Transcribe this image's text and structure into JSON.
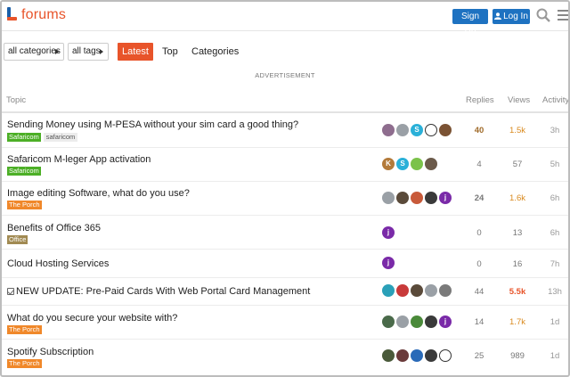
{
  "header": {
    "logo_text": "forums",
    "signup_label": "Sign Up",
    "login_label": "Log In"
  },
  "nav": {
    "categories_dropdown": "all categories",
    "tags_dropdown": "all tags",
    "tabs": [
      {
        "label": "Latest",
        "active": true
      },
      {
        "label": "Top",
        "active": false
      },
      {
        "label": "Categories",
        "active": false
      }
    ]
  },
  "advertisement": "ADVERTISEMENT",
  "table": {
    "headers": {
      "topic": "Topic",
      "replies": "Replies",
      "views": "Views",
      "activity": "Activity"
    },
    "rows": [
      {
        "title": "Sending Money using M-PESA without your sim card a good thing?",
        "category": "Safaricom",
        "tag": "safaricom",
        "replies": "40",
        "views": "1.5k",
        "activity": "3h"
      },
      {
        "title": "Safaricom M-leger App activation",
        "category": "Safaricom",
        "tag": "",
        "replies": "4",
        "views": "57",
        "activity": "5h"
      },
      {
        "title": "Image editing Software, what do you use?",
        "category": "The Porch",
        "tag": "",
        "replies": "24",
        "views": "1.6k",
        "activity": "6h"
      },
      {
        "title": "Benefits of Office 365",
        "category": "Office",
        "tag": "",
        "replies": "0",
        "views": "13",
        "activity": "6h"
      },
      {
        "title": "Cloud Hosting Services",
        "category": "",
        "tag": "",
        "replies": "0",
        "views": "16",
        "activity": "7h"
      },
      {
        "title": "NEW UPDATE: Pre-Paid Cards With Web Portal Card Management",
        "category": "",
        "tag": "",
        "replies": "44",
        "views": "5.5k",
        "activity": "13h"
      },
      {
        "title": "What do you secure your website with?",
        "category": "The Porch",
        "tag": "",
        "replies": "14",
        "views": "1.7k",
        "activity": "1d"
      },
      {
        "title": "Spotify Subscription",
        "category": "The Porch",
        "tag": "",
        "replies": "25",
        "views": "989",
        "activity": "1d"
      }
    ]
  },
  "colors": {
    "brand_orange": "#e8542a",
    "brand_blue": "#1e72c1",
    "cat_safaricom": "#4caf26",
    "cat_porch": "#f0882a",
    "cat_office": "#a18a52",
    "views_hot": "#d98a1f",
    "views_hotter": "#e8542a"
  }
}
